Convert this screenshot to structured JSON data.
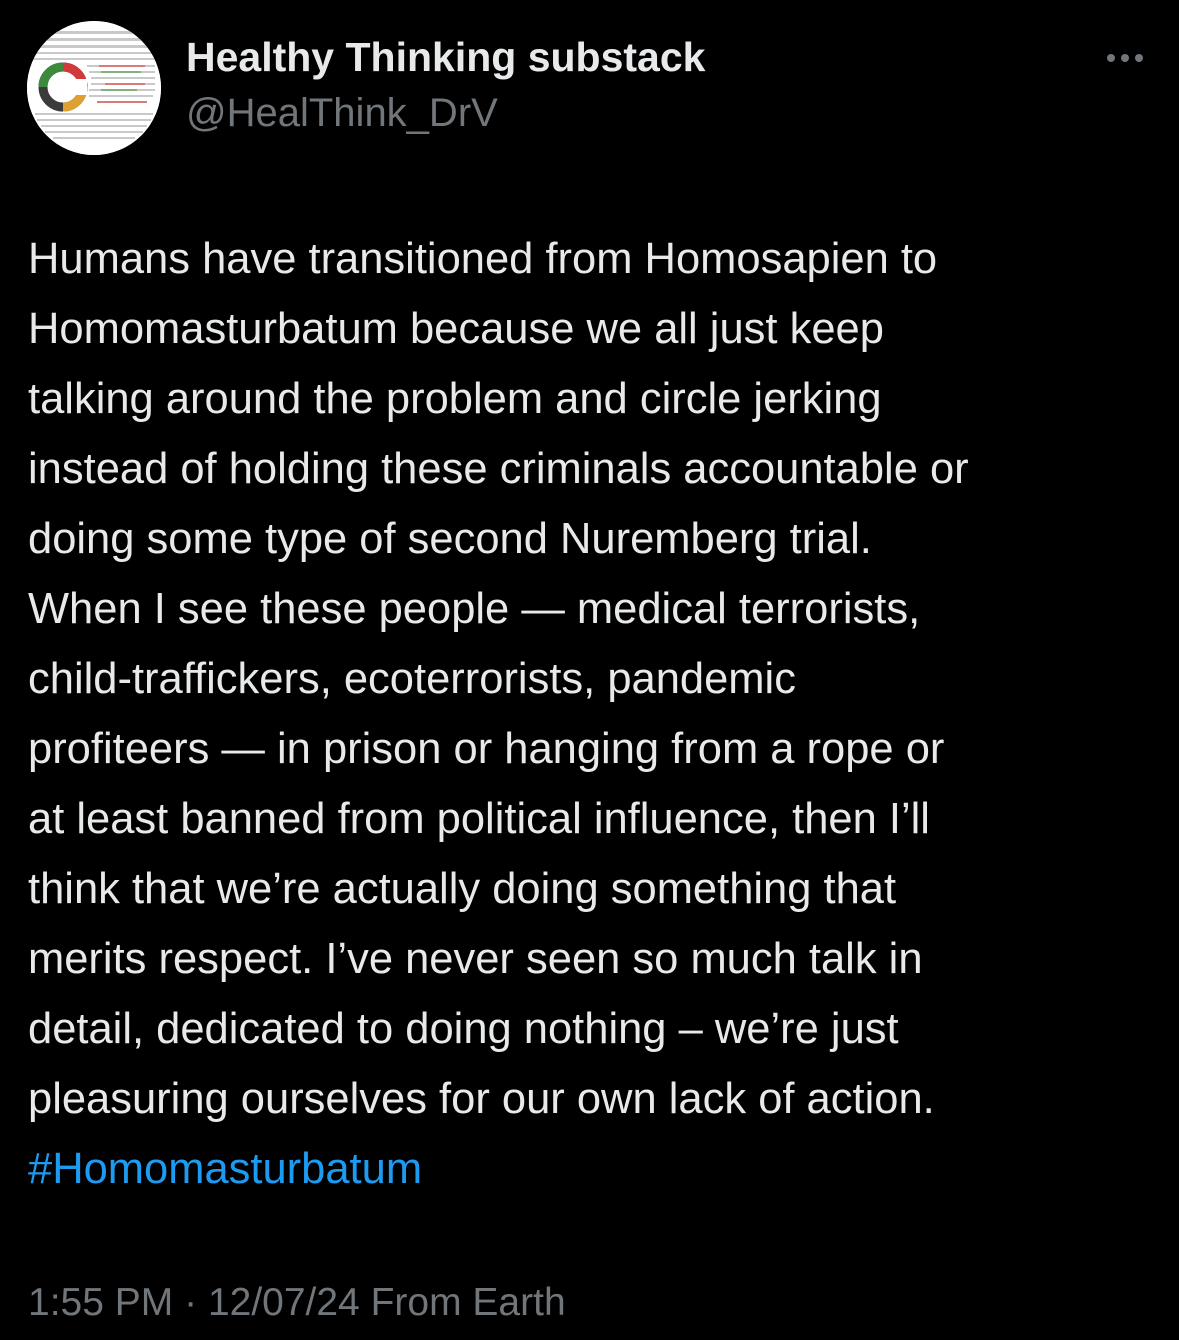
{
  "author": {
    "display_name": "Healthy Thinking substack",
    "handle": "@HealThink_DrV",
    "avatar_icon": "infographic-avatar"
  },
  "more_icon": "ellipsis-icon",
  "tweet": {
    "lines": [
      "Humans have transitioned from Homosapien to",
      "Homomasturbatum because we all just keep",
      "talking around the problem and circle jerking",
      "instead of holding these criminals accountable or",
      "doing some type of second Nuremberg trial.",
      "When I see these people — medical terrorists,",
      "child-traffickers, ecoterrorists, pandemic",
      "profiteers — in prison or hanging from a rope or",
      "at least banned from political influence, then I’ll",
      "think that we’re actually doing something that",
      "merits respect. I’ve never seen so much talk in",
      "detail, dedicated to doing nothing – we’re just",
      "pleasuring ourselves for our own lack of action."
    ],
    "hashtag": "#Homomasturbatum"
  },
  "meta": {
    "time": "1:55 PM",
    "separator": "·",
    "date": "12/07/24",
    "source": "From Earth"
  },
  "colors": {
    "background": "#000000",
    "text": "#e7e9ea",
    "secondary": "#71767b",
    "link": "#1d9bf0"
  }
}
